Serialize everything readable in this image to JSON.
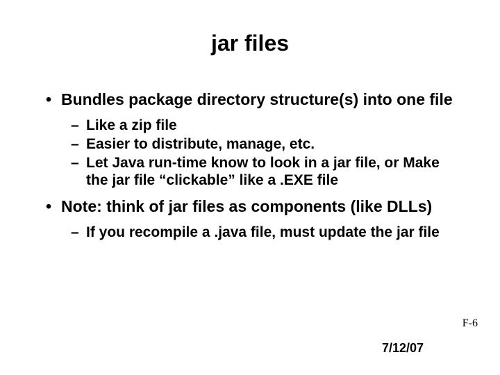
{
  "title": "jar files",
  "bullets": {
    "b1a": "Bundles package directory structure(s) into one file",
    "b1a_sub1": "Like a zip file",
    "b1a_sub2": "Easier to distribute, manage, etc.",
    "b1a_sub3": "Let Java run-time know to look in a jar file, or Make the jar file “clickable” like a .EXE file",
    "b1b": "Note: think of jar files as components (like DLLs)",
    "b1b_sub1": "If you recompile a .java file, must update the jar file"
  },
  "footer": {
    "pagenum": "F-6",
    "date": "7/12/07"
  }
}
